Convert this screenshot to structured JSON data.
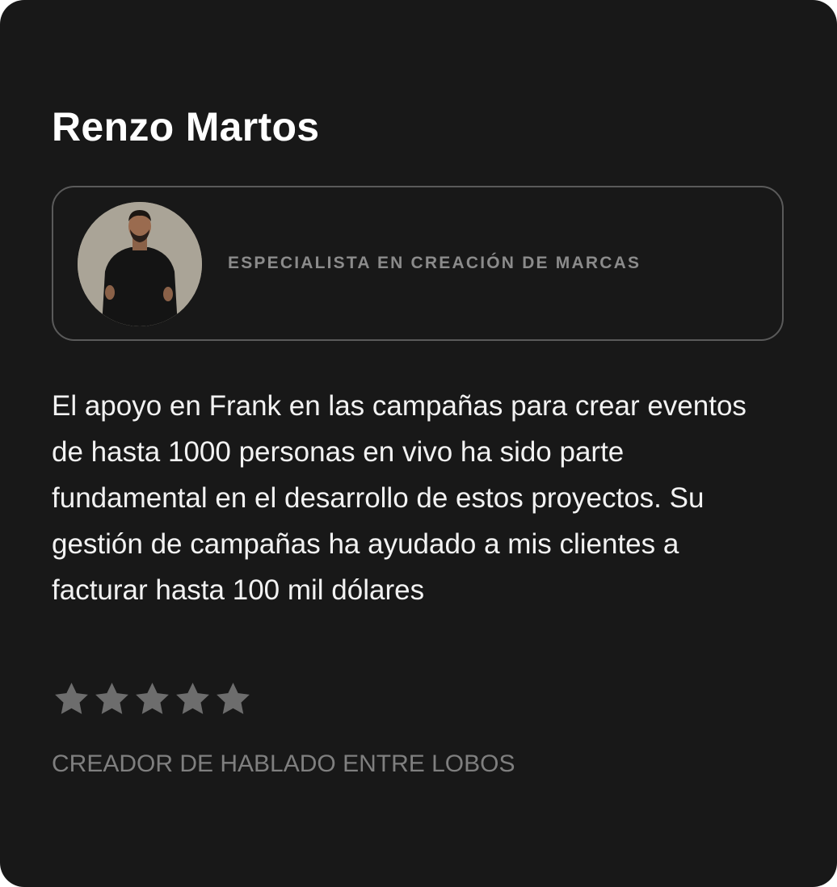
{
  "testimonial_card": {
    "name": "Renzo Martos",
    "avatar_alt": "Renzo Martos",
    "role": "ESPECIALISTA EN CREACIÓN DE MARCAS",
    "quote": "El apoyo en Frank en las campañas para crear eventos de hasta 1000 personas en vivo ha sido parte fundamental en el desarrollo de estos proyectos. Su gestión de campañas ha ayudado a mis clientes a facturar hasta 100 mil dólares",
    "rating": {
      "value": 5,
      "max": 5,
      "icon": "star-icon",
      "color": "#6d6d6d"
    },
    "author_caption": "CREADOR DE HABLADO ENTRE LOBOS"
  },
  "colors": {
    "card_background": "#181818",
    "text_primary": "#ffffff",
    "text_secondary": "#8b8b8b",
    "border": "#5a5a5a"
  }
}
